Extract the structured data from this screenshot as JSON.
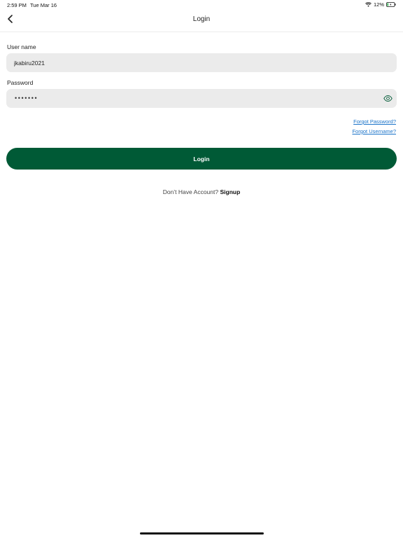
{
  "status_bar": {
    "time": "2:59 PM",
    "date": "Tue Mar 16",
    "battery": "12%"
  },
  "nav": {
    "title": "Login"
  },
  "form": {
    "username_label": "User name",
    "username_value": "jkabiru2021",
    "password_label": "Password",
    "password_mask": "•••••••"
  },
  "links": {
    "forgot_password": "Forgot Password?",
    "forgot_username": "Forgot Username?"
  },
  "login_button": "Login",
  "signup": {
    "prompt": "Don’t Have Account?",
    "link": "Signup"
  },
  "colors": {
    "primary": "#005a36",
    "link": "#1a73c9",
    "input_bg": "#ebebeb"
  }
}
